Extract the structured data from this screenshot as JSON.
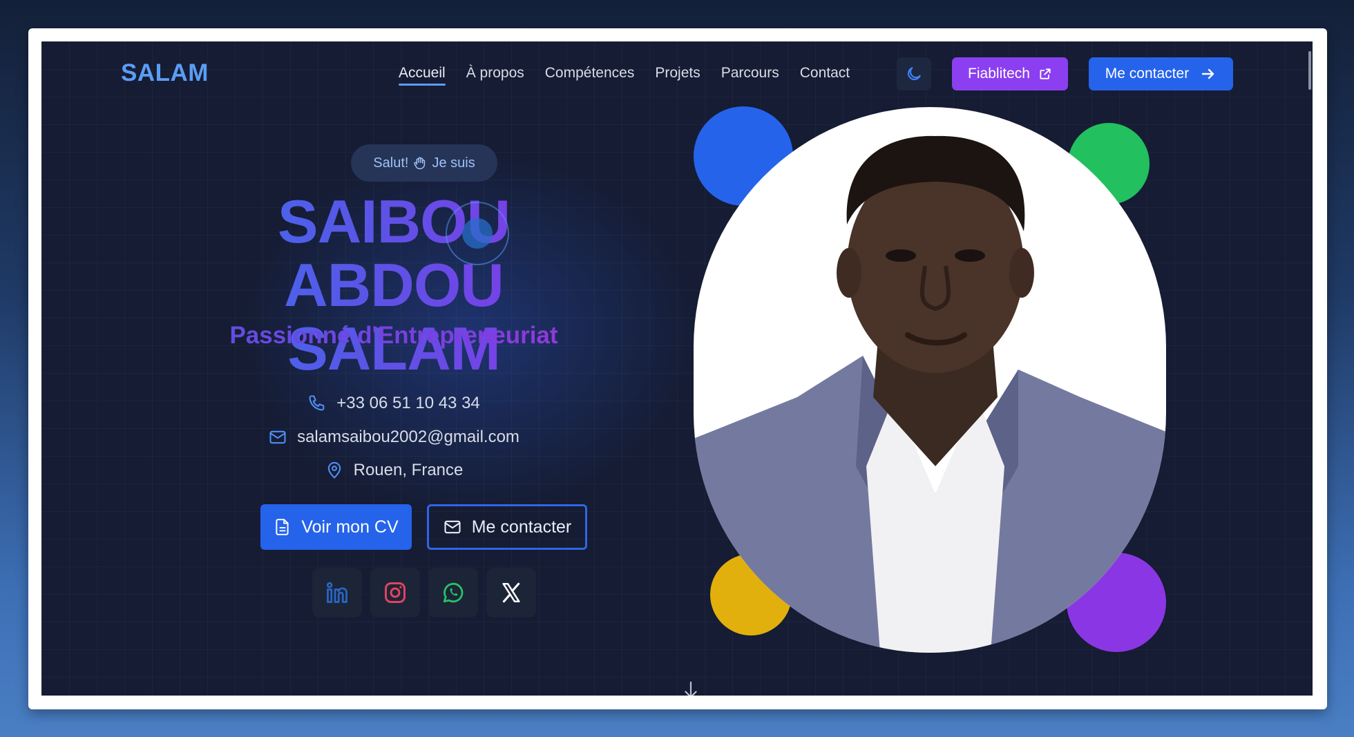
{
  "nav": {
    "logo": "SALAM",
    "links": [
      "Accueil",
      "À propos",
      "Compétences",
      "Projets",
      "Parcours",
      "Contact"
    ],
    "fiablitech_label": "Fiablitech",
    "contact_label": "Me contacter"
  },
  "hero": {
    "badge_pre": "Salut!",
    "badge_post": "Je suis",
    "name_line1": "SAIBOU ABDOU",
    "name_line2": "SALAM",
    "tagline": "Passionné d'Entrepreneuriat",
    "phone": "+33 06 51 10 43 34",
    "email": "salamsaibou2002@gmail.com",
    "location": "Rouen, France",
    "cv_label": "Voir mon CV",
    "contact_label": "Me contacter"
  },
  "socials": [
    "linkedin-icon",
    "instagram-icon",
    "whatsapp-icon",
    "x-icon"
  ],
  "colors": {
    "accent_blue": "#2563eb",
    "accent_purple": "#8b3ff0",
    "blob_blue": "#2563eb",
    "blob_green": "#22c05e",
    "blob_yellow": "#e2b00c",
    "blob_purple": "#8b36e4",
    "background": "#151c33"
  }
}
